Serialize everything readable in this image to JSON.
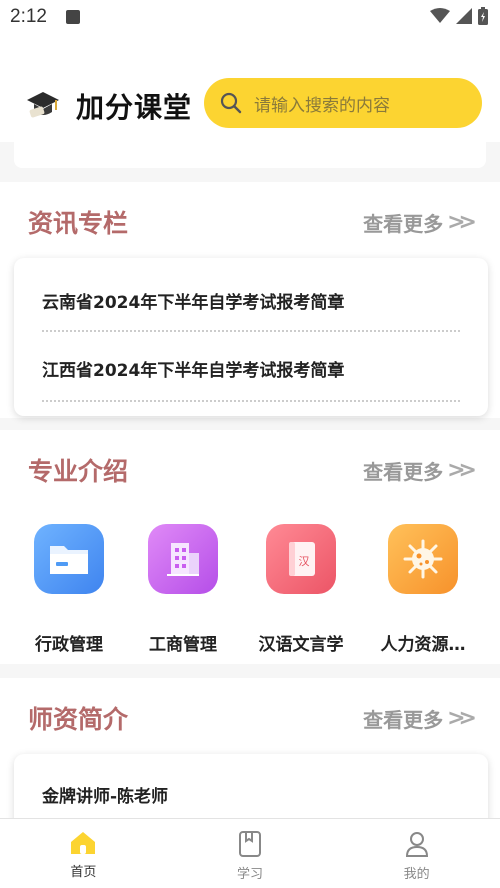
{
  "status_bar": {
    "time": "2:12"
  },
  "header": {
    "app_title": "加分课堂",
    "search_placeholder": "请输入搜索的内容",
    "accent_color": "#fcd431"
  },
  "news": {
    "title": "资讯专栏",
    "more": "查看更多",
    "items": [
      "云南省2024年下半年自学考试报考简章",
      "江西省2024年下半年自学考试报考简章"
    ]
  },
  "majors": {
    "title": "专业介绍",
    "more": "查看更多",
    "items": [
      {
        "label": "行政管理",
        "icon": "folder-card-icon",
        "color": "#4f9bf5"
      },
      {
        "label": "工商管理",
        "icon": "building-icon",
        "color": "#c95ef0"
      },
      {
        "label": "汉语文言学",
        "icon": "book-icon",
        "color": "#f26b7a",
        "glyph": "汉"
      },
      {
        "label": "人力资源…",
        "icon": "virus-icon",
        "color": "#f9a73e"
      }
    ]
  },
  "teachers": {
    "title": "师资简介",
    "more": "查看更多",
    "items": [
      "金牌讲师-陈老师"
    ]
  },
  "bottom_nav": {
    "items": [
      {
        "label": "首页",
        "icon": "home-icon",
        "active": true
      },
      {
        "label": "学习",
        "icon": "study-icon",
        "active": false
      },
      {
        "label": "我的",
        "icon": "profile-icon",
        "active": false
      }
    ]
  }
}
